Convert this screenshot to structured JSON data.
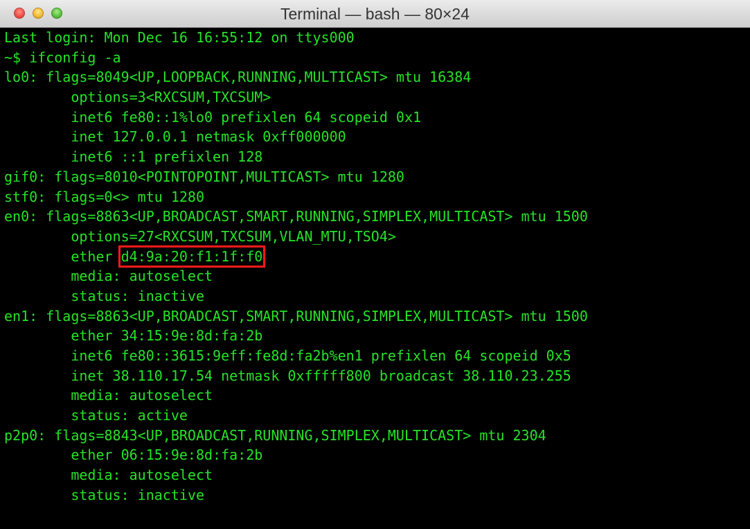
{
  "window": {
    "title": "Terminal — bash — 80×24"
  },
  "colors": {
    "text": "#27e327",
    "background": "#000000",
    "highlight_box": "#ff1a1a"
  },
  "terminal": {
    "lines": [
      "Last login: Mon Dec 16 16:55:12 on ttys000",
      "~$ ifconfig -a",
      "lo0: flags=8049<UP,LOOPBACK,RUNNING,MULTICAST> mtu 16384",
      "        options=3<RXCSUM,TXCSUM>",
      "        inet6 fe80::1%lo0 prefixlen 64 scopeid 0x1",
      "        inet 127.0.0.1 netmask 0xff000000",
      "        inet6 ::1 prefixlen 128",
      "gif0: flags=8010<POINTOPOINT,MULTICAST> mtu 1280",
      "stf0: flags=0<> mtu 1280",
      "en0: flags=8863<UP,BROADCAST,SMART,RUNNING,SIMPLEX,MULTICAST> mtu 1500",
      "        options=27<RXCSUM,TXCSUM,VLAN_MTU,TSO4>",
      {
        "prefix": "        ether ",
        "highlight": "d4:9a:20:f1:1f:f0"
      },
      "        media: autoselect",
      "        status: inactive",
      "en1: flags=8863<UP,BROADCAST,SMART,RUNNING,SIMPLEX,MULTICAST> mtu 1500",
      "        ether 34:15:9e:8d:fa:2b",
      "        inet6 fe80::3615:9eff:fe8d:fa2b%en1 prefixlen 64 scopeid 0x5",
      "        inet 38.110.17.54 netmask 0xfffff800 broadcast 38.110.23.255",
      "        media: autoselect",
      "        status: active",
      "p2p0: flags=8843<UP,BROADCAST,RUNNING,SIMPLEX,MULTICAST> mtu 2304",
      "        ether 06:15:9e:8d:fa:2b",
      "        media: autoselect",
      "        status: inactive"
    ]
  }
}
